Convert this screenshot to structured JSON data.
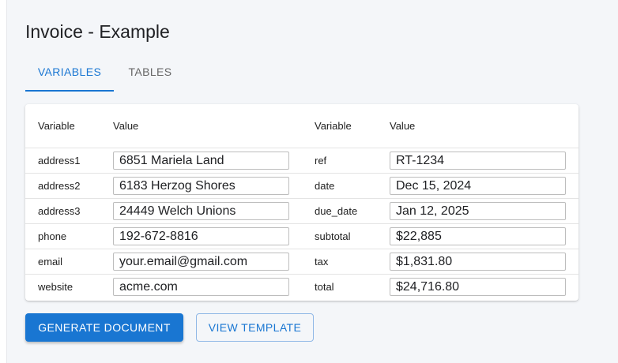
{
  "page": {
    "title": "Invoice - Example"
  },
  "tabs": [
    {
      "label": "VARIABLES",
      "active": true
    },
    {
      "label": "TABLES",
      "active": false
    }
  ],
  "table": {
    "headers": [
      "Variable",
      "Value",
      "Variable",
      "Value"
    ],
    "rows": [
      {
        "var1": "address1",
        "val1": "6851 Mariela Land",
        "var2": "ref",
        "val2": "RT-1234"
      },
      {
        "var1": "address2",
        "val1": "6183 Herzog Shores",
        "var2": "date",
        "val2": "Dec 15, 2024"
      },
      {
        "var1": "address3",
        "val1": "24449 Welch Unions",
        "var2": "due_date",
        "val2": "Jan 12, 2025"
      },
      {
        "var1": "phone",
        "val1": "192-672-8816",
        "var2": "subtotal",
        "val2": "$22,885"
      },
      {
        "var1": "email",
        "val1": "your.email@gmail.com",
        "var2": "tax",
        "val2": "$1,831.80"
      },
      {
        "var1": "website",
        "val1": "acme.com",
        "var2": "total",
        "val2": "$24,716.80"
      }
    ]
  },
  "actions": {
    "generate_label": "GENERATE DOCUMENT",
    "view_label": "VIEW TEMPLATE"
  },
  "colors": {
    "accent": "#1976d2",
    "background": "#f4f6f9"
  }
}
